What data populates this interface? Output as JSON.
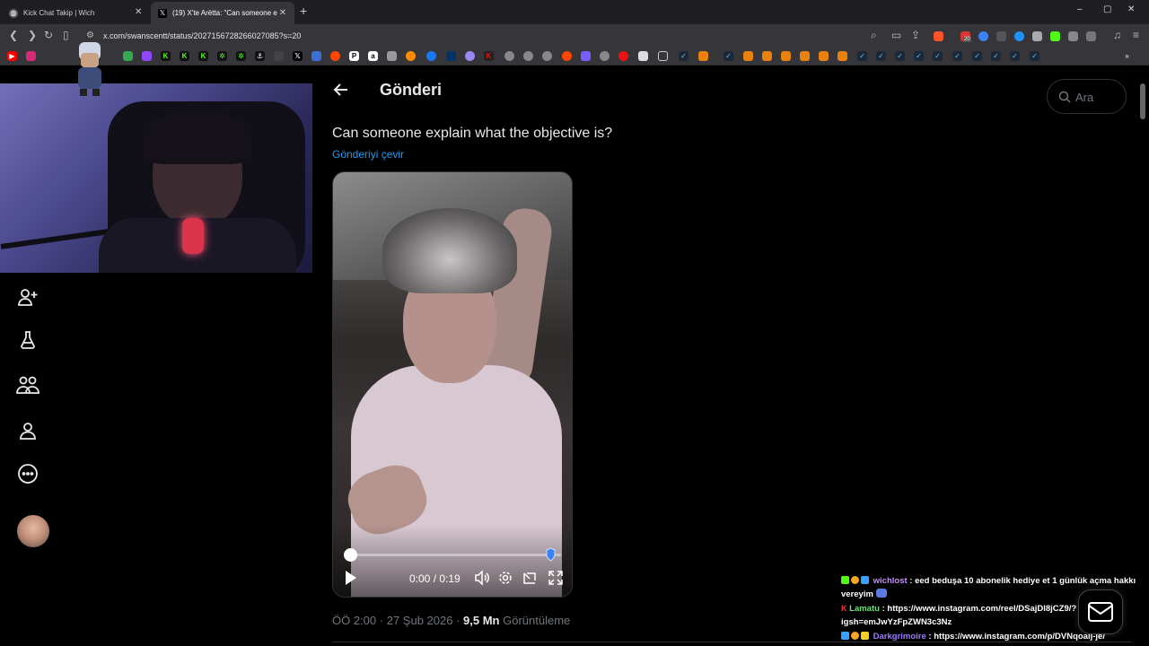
{
  "browser": {
    "tabs": [
      {
        "label": "Kick Chat Takip | Wich",
        "active": false
      },
      {
        "label": "(19) X'te Arëtta: \"Can someone e",
        "active": true
      }
    ],
    "new_tab_label": "+",
    "url": "x.com/swanscentt/status/2027156728266027085?s=20",
    "window_controls": {
      "minimize": "–",
      "maximize": "▢",
      "close": "✕"
    },
    "extension_badge": "20"
  },
  "page": {
    "title": "Gönderi",
    "search_placeholder": "Ara"
  },
  "tweet": {
    "text": "Can someone explain what the objective is?",
    "translate_link": "Gönderiyi çevir",
    "time": "ÖÖ 2:00",
    "date": "27 Şub 2026",
    "views_count": "9,5 Mn",
    "views_label": "Görüntüleme",
    "video": {
      "time_current": "0:00",
      "time_total": "0:19",
      "progress": 0.0
    }
  },
  "sidenav": {
    "items": [
      "follow",
      "labs",
      "communities",
      "profile",
      "more"
    ]
  },
  "chat": [
    {
      "user": "wichlost",
      "user_color": "#c58bff",
      "message": "eed beduşa 10 abonelik hediye et 1 günlük açma hakkı vereyim"
    },
    {
      "user": "Lamatu",
      "user_color": "#6ee37a",
      "message": "https://www.instagram.com/reel/DSajDl8jCZ9/?igsh=emJwYzFpZWN3c3Nz"
    },
    {
      "user": "Darkgrimoire",
      "user_color": "#9c7bff",
      "message": "https://www.instagram.com/p/DVNqoalj-je/"
    }
  ],
  "colors": {
    "accent": "#1d9bf0",
    "background": "#000000",
    "muted": "#71767b"
  }
}
